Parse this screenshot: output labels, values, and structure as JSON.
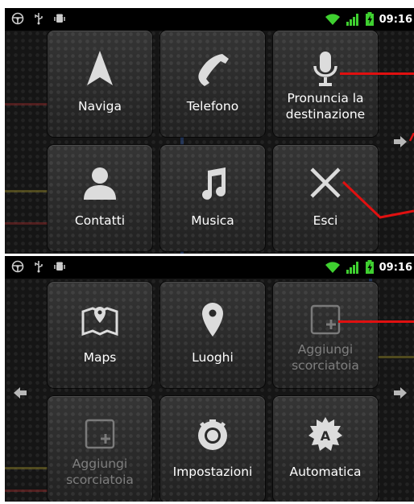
{
  "status_bar": {
    "time": "09:16",
    "icons": [
      "steering-wheel-icon",
      "usb-icon",
      "android-debug-icon",
      "wifi-icon",
      "signal-icon",
      "battery-icon"
    ]
  },
  "screen1": {
    "tiles": [
      {
        "label": "Naviga",
        "icon": "navigation-arrow-icon"
      },
      {
        "label": "Telefono",
        "icon": "phone-icon"
      },
      {
        "label": "Pronuncia la destinazione",
        "icon": "microphone-icon"
      },
      {
        "label": "Contatti",
        "icon": "contact-person-icon"
      },
      {
        "label": "Musica",
        "icon": "music-note-icon"
      },
      {
        "label": "Esci",
        "icon": "close-x-icon"
      }
    ]
  },
  "screen2": {
    "tiles": [
      {
        "label": "Maps",
        "icon": "maps-icon"
      },
      {
        "label": "Luoghi",
        "icon": "place-pin-icon"
      },
      {
        "label": "Aggiungi scorciatoia",
        "icon": "add-shortcut-icon",
        "disabled": true
      },
      {
        "label": "Aggiungi scorciatoia",
        "icon": "add-shortcut-icon",
        "disabled": true
      },
      {
        "label": "Impostazioni",
        "icon": "settings-dial-icon"
      },
      {
        "label": "Automatica",
        "icon": "auto-mode-icon"
      }
    ]
  },
  "colors": {
    "annotation_line": "#e01010",
    "tile_label": "#ffffff",
    "tile_label_disabled": "#7e7e7e"
  }
}
